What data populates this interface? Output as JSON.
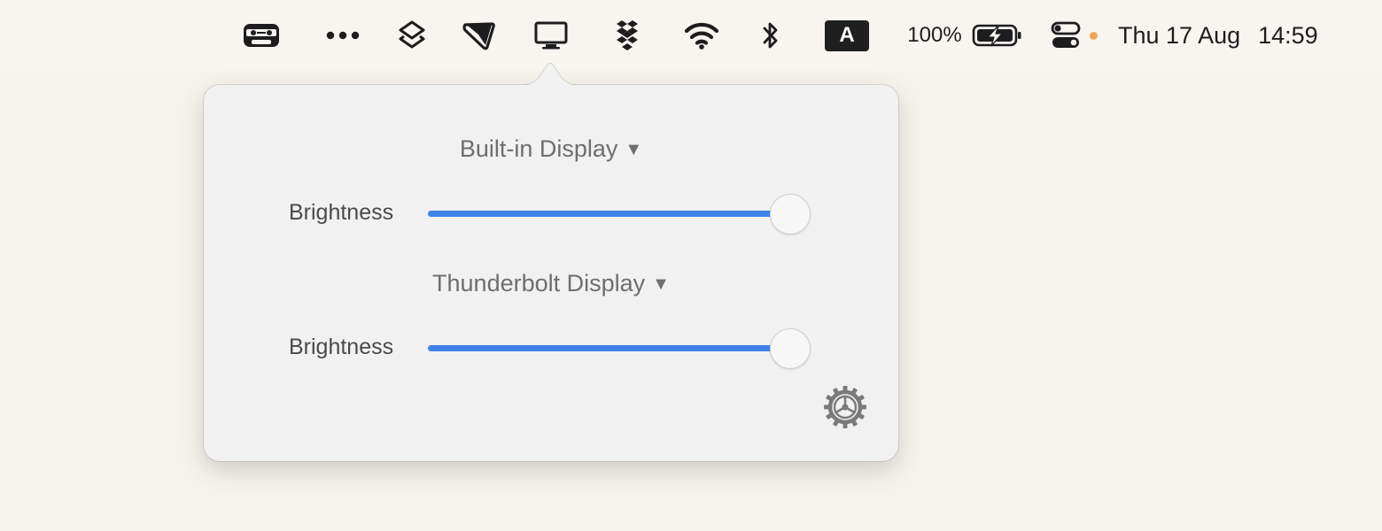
{
  "menubar": {
    "icons": {
      "cassette": "cassette-icon",
      "more": "more-dots-icon",
      "shortcuts": "shortcuts-icon",
      "flag": "flag-icon",
      "display": "display-icon",
      "dropbox": "dropbox-icon",
      "wifi": "wifi-icon",
      "bluetooth": "bluetooth-icon",
      "control_center": "control-center-icon"
    },
    "input_source": "A",
    "battery_percent": "100%",
    "date": "Thu 17 Aug",
    "time": "14:59"
  },
  "popover": {
    "displays": [
      {
        "name": "Built-in Display",
        "caret": "▼",
        "brightness_label": "Brightness",
        "brightness": 0.95
      },
      {
        "name": "Thunderbolt Display",
        "caret": "▼",
        "brightness_label": "Brightness",
        "brightness": 0.95
      }
    ],
    "settings_icon": "gear-icon"
  },
  "colors": {
    "accent": "#3f83e9",
    "menubar_bg": "#f8f5f0",
    "desktop_bg": "#f6f2ec",
    "popover_bg": "#f1f1f1",
    "status_dot": "#f2a455"
  }
}
